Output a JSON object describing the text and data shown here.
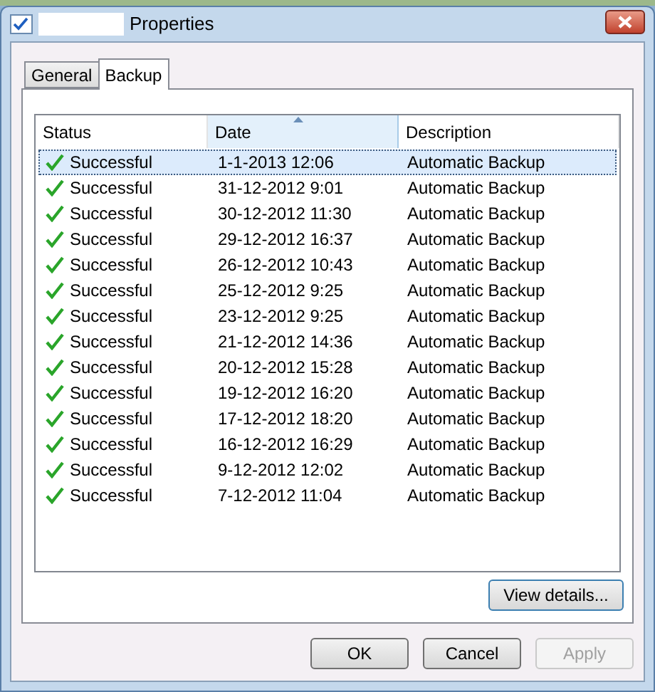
{
  "window": {
    "title": "Properties"
  },
  "tabs": [
    {
      "label": "General",
      "selected": false
    },
    {
      "label": "Backup",
      "selected": true
    }
  ],
  "table": {
    "columns": [
      {
        "label": "Status",
        "sorted": false
      },
      {
        "label": "Date",
        "sorted": true
      },
      {
        "label": "Description",
        "sorted": false
      }
    ],
    "rows": [
      {
        "status": "Successful",
        "date": "1-1-2013 12:06",
        "description": "Automatic Backup",
        "selected": true
      },
      {
        "status": "Successful",
        "date": "31-12-2012 9:01",
        "description": "Automatic Backup",
        "selected": false
      },
      {
        "status": "Successful",
        "date": "30-12-2012 11:30",
        "description": "Automatic Backup",
        "selected": false
      },
      {
        "status": "Successful",
        "date": "29-12-2012 16:37",
        "description": "Automatic Backup",
        "selected": false
      },
      {
        "status": "Successful",
        "date": "26-12-2012 10:43",
        "description": "Automatic Backup",
        "selected": false
      },
      {
        "status": "Successful",
        "date": "25-12-2012 9:25",
        "description": "Automatic Backup",
        "selected": false
      },
      {
        "status": "Successful",
        "date": "23-12-2012 9:25",
        "description": "Automatic Backup",
        "selected": false
      },
      {
        "status": "Successful",
        "date": "21-12-2012 14:36",
        "description": "Automatic Backup",
        "selected": false
      },
      {
        "status": "Successful",
        "date": "20-12-2012 15:28",
        "description": "Automatic Backup",
        "selected": false
      },
      {
        "status": "Successful",
        "date": "19-12-2012 16:20",
        "description": "Automatic Backup",
        "selected": false
      },
      {
        "status": "Successful",
        "date": "17-12-2012 18:20",
        "description": "Automatic Backup",
        "selected": false
      },
      {
        "status": "Successful",
        "date": "16-12-2012 16:29",
        "description": "Automatic Backup",
        "selected": false
      },
      {
        "status": "Successful",
        "date": "9-12-2012 12:02",
        "description": "Automatic Backup",
        "selected": false
      },
      {
        "status": "Successful",
        "date": "7-12-2012 11:04",
        "description": "Automatic Backup",
        "selected": false
      }
    ]
  },
  "details_button": {
    "label": "View details...",
    "disabled": false
  },
  "buttons": [
    {
      "label": "OK",
      "disabled": false
    },
    {
      "label": "Cancel",
      "disabled": false
    },
    {
      "label": "Apply",
      "disabled": true
    }
  ]
}
